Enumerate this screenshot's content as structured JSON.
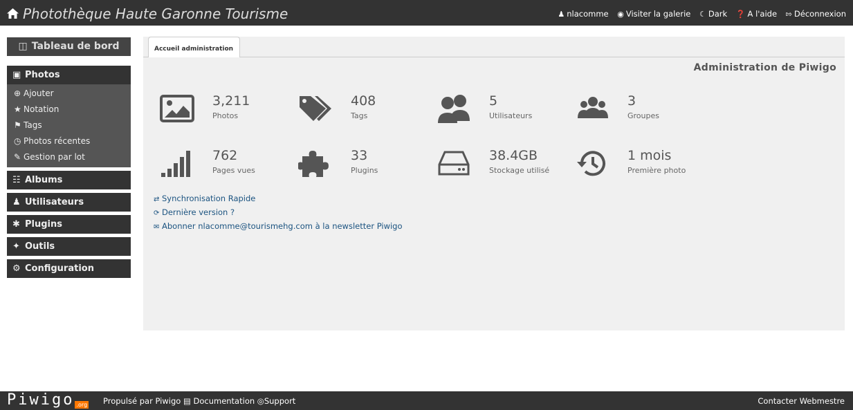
{
  "header": {
    "title": "Photothèque Haute Garonne Tourisme",
    "nav": [
      {
        "label": "nlacomme",
        "icon": "user-icon"
      },
      {
        "label": "Visiter la galerie",
        "icon": "eye-icon"
      },
      {
        "label": "Dark",
        "icon": "moon-icon"
      },
      {
        "label": "A l'aide",
        "icon": "help-icon"
      },
      {
        "label": "Déconnexion",
        "icon": "logout-icon"
      }
    ]
  },
  "sidebar": {
    "dashboard_label": "Tableau de bord",
    "sections": [
      {
        "label": "Photos",
        "icon": "image-icon",
        "items": [
          {
            "label": "Ajouter",
            "icon": "plus-circle-icon"
          },
          {
            "label": "Notation",
            "icon": "star-icon"
          },
          {
            "label": "Tags",
            "icon": "tags-icon"
          },
          {
            "label": "Photos récentes",
            "icon": "clock-icon"
          },
          {
            "label": "Gestion par lot",
            "icon": "pencil-icon"
          }
        ]
      },
      {
        "label": "Albums",
        "icon": "sitemap-icon"
      },
      {
        "label": "Utilisateurs",
        "icon": "users-icon"
      },
      {
        "label": "Plugins",
        "icon": "puzzle-icon"
      },
      {
        "label": "Outils",
        "icon": "wrench-icon"
      },
      {
        "label": "Configuration",
        "icon": "gear-icon"
      }
    ]
  },
  "main": {
    "tab_label": "Accueil administration",
    "title": "Administration de Piwigo",
    "stats": [
      {
        "value": "3,211",
        "label": "Photos",
        "icon": "picture-icon"
      },
      {
        "value": "408",
        "label": "Tags",
        "icon": "tags-icon"
      },
      {
        "value": "5",
        "label": "Utilisateurs",
        "icon": "users-icon"
      },
      {
        "value": "3",
        "label": "Groupes",
        "icon": "group-icon"
      },
      {
        "value": "762",
        "label": "Pages vues",
        "icon": "signal-icon"
      },
      {
        "value": "33",
        "label": "Plugins",
        "icon": "puzzle-icon"
      },
      {
        "value": "38.4GB",
        "label": "Stockage utilisé",
        "icon": "hdd-icon"
      },
      {
        "value": "1 mois",
        "label": "Première photo",
        "icon": "history-icon"
      }
    ],
    "links": [
      {
        "label": "Synchronisation Rapide",
        "icon": "exchange-icon"
      },
      {
        "label": "Dernière version ?",
        "icon": "refresh-icon"
      },
      {
        "label": "Abonner nlacomme@tourismehg.com à la newsletter Piwigo",
        "icon": "envelope-icon"
      }
    ]
  },
  "footer": {
    "logo_text": "Piwigo",
    "logo_suffix": ".org",
    "powered": "Propulsé par Piwigo",
    "documentation": "Documentation",
    "support": "Support",
    "contact": "Contacter Webmestre"
  },
  "colors": {
    "topbar": "#333333",
    "sidebar_head": "#333333",
    "sidebar_sub": "#555555",
    "main_bg": "#f0f0f0",
    "link": "#1b5380",
    "logo_accent": "#ff7700"
  }
}
